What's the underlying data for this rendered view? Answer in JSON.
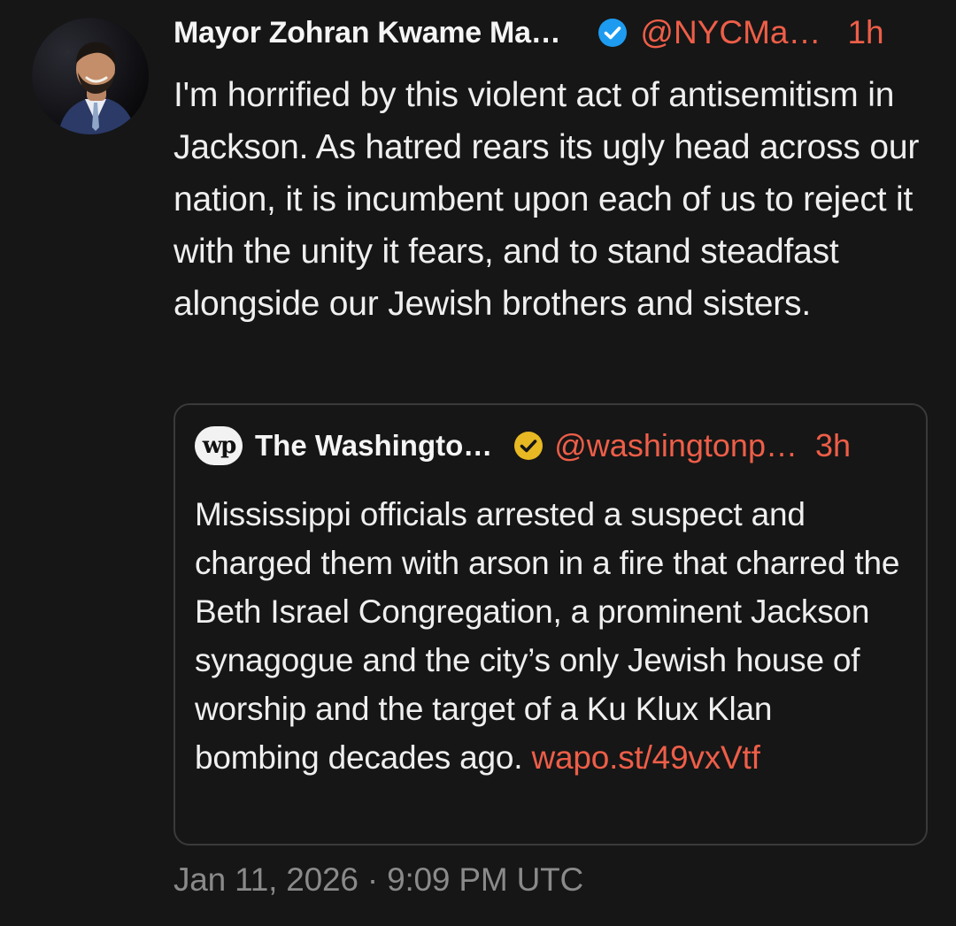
{
  "tweet": {
    "author_name": "Mayor Zohran Kwame Ma…",
    "handle": "@NYCMa…",
    "time": "1h",
    "text": "I'm horrified by this violent act of antisemitism in Jackson. As hatred rears its ugly head across our nation, it is incumbent upon each of us to reject it with the unity it fears, and to stand steadfast alongside our Jewish brothers and sisters.",
    "avatar_icon": "user-avatar-photo",
    "verified_icon": "verified-badge-icon",
    "verified_color": "#1d9bf0"
  },
  "quote": {
    "logo_text": "wp",
    "author_name": "The Washingto…",
    "handle": "@washingtonp…",
    "time": "3h",
    "text": "Mississippi officials arrested a suspect and charged them with arson in a fire that charred the Beth Israel Congregation, a prominent Jackson synagogue and the city’s only Jewish house of worship and the target of a Ku Klux Klan bombing decades ago.",
    "link": "wapo.st/49vxVtf",
    "verified_icon": "verified-badge-icon",
    "verified_color": "#e8b923"
  },
  "timestamp": "Jan 11, 2026 · 9:09 PM UTC",
  "colors": {
    "background": "#161616",
    "accent": "#ee5e48",
    "muted": "#8a8a8a"
  }
}
